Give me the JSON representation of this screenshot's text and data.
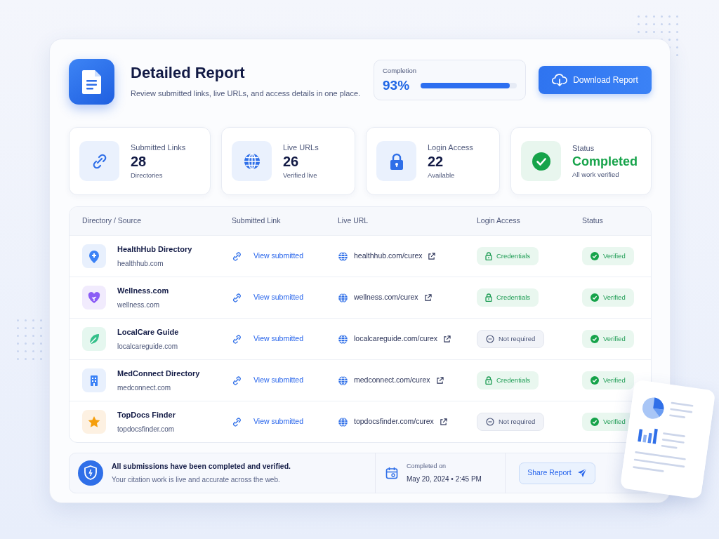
{
  "header": {
    "title": "Detailed Report",
    "subtitle": "Review submitted links, live URLs, and access details in one place.",
    "completion": {
      "label": "Completion",
      "value": "93%",
      "level": 0.93
    },
    "download_button": "Download Report"
  },
  "stats": [
    {
      "kind": "link",
      "label": "Submitted Links",
      "value": "28",
      "note": "Directories"
    },
    {
      "kind": "globe",
      "label": "Live URLs",
      "value": "26",
      "note": "Verified live"
    },
    {
      "kind": "lock",
      "label": "Login Access",
      "value": "22",
      "note": "Available"
    },
    {
      "kind": "check",
      "label": "Status",
      "value": "Completed",
      "note": "All work verified"
    }
  ],
  "table": {
    "columns": [
      "Directory / Source",
      "Submitted Link",
      "Live URL",
      "Login Access",
      "Status"
    ],
    "rows": [
      {
        "kind": "pin",
        "color": "#3b82f6",
        "name": "HealthHub Directory",
        "domain": "healthhub.com",
        "submitted": "View submitted",
        "live_url": "healthhub.com/curex",
        "access": {
          "kind": "credentials",
          "label": "Credentials"
        },
        "status": "Verified"
      },
      {
        "kind": "heart",
        "color": "#8b5cf6",
        "name": "Wellness.com",
        "domain": "wellness.com",
        "submitted": "View submitted",
        "live_url": "wellness.com/curex",
        "access": {
          "kind": "credentials",
          "label": "Credentials"
        },
        "status": "Verified"
      },
      {
        "kind": "leaf",
        "color": "#34c08a",
        "name": "LocalCare Guide",
        "domain": "localcareguide.com",
        "submitted": "View submitted",
        "live_url": "localcareguide.com/curex",
        "access": {
          "kind": "not_required",
          "label": "Not required"
        },
        "status": "Verified"
      },
      {
        "kind": "building",
        "color": "#3b82f6",
        "name": "MedConnect Directory",
        "domain": "medconnect.com",
        "submitted": "View submitted",
        "live_url": "medconnect.com/curex",
        "access": {
          "kind": "credentials",
          "label": "Credentials"
        },
        "status": "Verified"
      },
      {
        "kind": "star",
        "color": "#f59e0b",
        "name": "TopDocs Finder",
        "domain": "topdocsfinder.com",
        "submitted": "View submitted",
        "live_url": "topdocsfinder.com/curex",
        "access": {
          "kind": "not_required",
          "label": "Not required"
        },
        "status": "Verified"
      }
    ]
  },
  "footer": {
    "message": "All submissions have been completed and verified.",
    "detail": "Your citation work is live and accurate across the web.",
    "completed_label": "Completed on",
    "completed_date": "May 20, 2024 • 2:45 PM",
    "share_button": "Share Report"
  }
}
